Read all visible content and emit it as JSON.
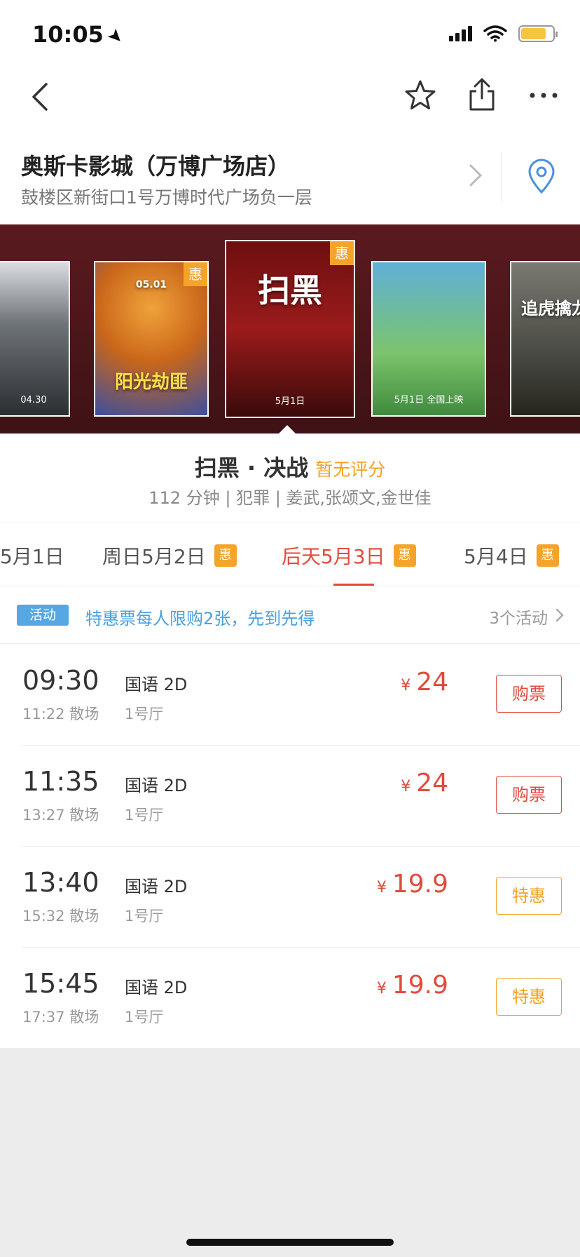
{
  "status_bar": {
    "time": "10:05"
  },
  "cinema": {
    "name": "奥斯卡影城（万博广场店）",
    "address": "鼓楼区新街口1号万博时代广场负一层"
  },
  "posters": [
    {
      "title": "",
      "note": "04.30",
      "badge": ""
    },
    {
      "title": "阳光劫匪",
      "note": "05.01",
      "badge": "惠"
    },
    {
      "title": "扫黑",
      "note": "5月1日",
      "badge": "惠"
    },
    {
      "title": "",
      "note": "5月1日 全国上映",
      "badge": ""
    },
    {
      "title": "追虎擒龙",
      "note": "",
      "badge": ""
    }
  ],
  "movie": {
    "title": "扫黑 · 决战",
    "rating": "暂无评分",
    "meta": "112 分钟 | 犯罪 | 姜武,张颂文,金世佳"
  },
  "date_tabs": [
    {
      "label": "5月1日",
      "badge": "",
      "active": false
    },
    {
      "label": "周日5月2日",
      "badge": "惠",
      "active": false
    },
    {
      "label": "后天5月3日",
      "badge": "惠",
      "active": true
    },
    {
      "label": "5月4日",
      "badge": "惠",
      "active": false
    }
  ],
  "activity": {
    "tag": "活动",
    "text": "特惠票每人限购2张，先到先得",
    "count": "3个活动"
  },
  "showtimes": [
    {
      "start": "09:30",
      "end": "11:22 散场",
      "lang": "国语 2D",
      "hall": "1号厅",
      "currency": "¥",
      "price": "24",
      "button": "购票",
      "deal": false
    },
    {
      "start": "11:35",
      "end": "13:27 散场",
      "lang": "国语 2D",
      "hall": "1号厅",
      "currency": "¥",
      "price": "24",
      "button": "购票",
      "deal": false
    },
    {
      "start": "13:40",
      "end": "15:32 散场",
      "lang": "国语 2D",
      "hall": "1号厅",
      "currency": "¥",
      "price": "19.9",
      "button": "特惠",
      "deal": true
    },
    {
      "start": "15:45",
      "end": "17:37 散场",
      "lang": "国语 2D",
      "hall": "1号厅",
      "currency": "¥",
      "price": "19.9",
      "button": "特惠",
      "deal": true
    }
  ],
  "colors": {
    "accent": "#e24a3b",
    "deal": "#f3a21e",
    "activity": "#56a7e3"
  }
}
